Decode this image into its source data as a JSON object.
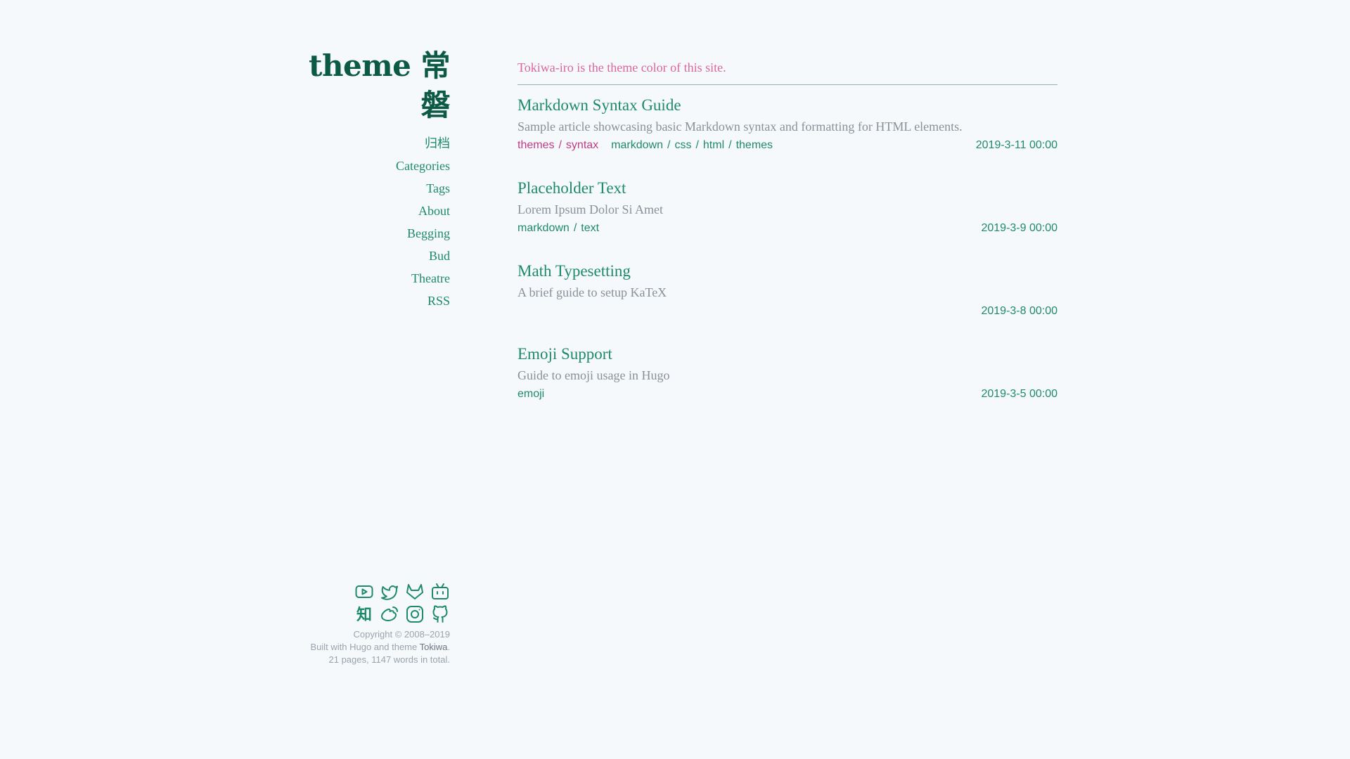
{
  "site": {
    "title": "theme 常磐",
    "tagline": "Tokiwa-iro is the theme color of this site."
  },
  "nav": [
    "归档",
    "Categories",
    "Tags",
    "About",
    "Begging",
    "Bud",
    "Theatre",
    "RSS"
  ],
  "social_icons": [
    [
      "youtube-icon",
      "twitter-icon",
      "gitlab-icon",
      "bilibili-icon"
    ],
    [
      "zhihu-icon",
      "weibo-icon",
      "instagram-icon",
      "github-icon"
    ]
  ],
  "zhihu_glyph": "知",
  "footer": {
    "copyright": "Copyright © 2008–2019",
    "built_prefix": "Built with Hugo and theme ",
    "theme_name": "Tokiwa",
    "built_suffix": ".",
    "stats": "21 pages, 1147 words in total."
  },
  "posts": [
    {
      "title": "Markdown Syntax Guide",
      "summary": "Sample article showcasing basic Markdown syntax and formatting for HTML elements.",
      "categories": [
        "themes",
        "syntax"
      ],
      "tags": [
        "markdown",
        "css",
        "html",
        "themes"
      ],
      "date": "2019-3-11 00:00"
    },
    {
      "title": "Placeholder Text",
      "summary": "Lorem Ipsum Dolor Si Amet",
      "categories": [],
      "tags": [
        "markdown",
        "text"
      ],
      "date": "2019-3-9 00:00"
    },
    {
      "title": "Math Typesetting",
      "summary": "A brief guide to setup KaTeX",
      "categories": [],
      "tags": [],
      "date": "2019-3-8 00:00"
    },
    {
      "title": "Emoji Support",
      "summary": "Guide to emoji usage in Hugo",
      "categories": [],
      "tags": [
        "emoji"
      ],
      "date": "2019-3-5 00:00"
    }
  ],
  "colors": {
    "accent": "#1f8a68",
    "title": "#0d5a44",
    "tagline": "#d9669e",
    "category": "#c23a85",
    "muted": "#8a9098"
  }
}
